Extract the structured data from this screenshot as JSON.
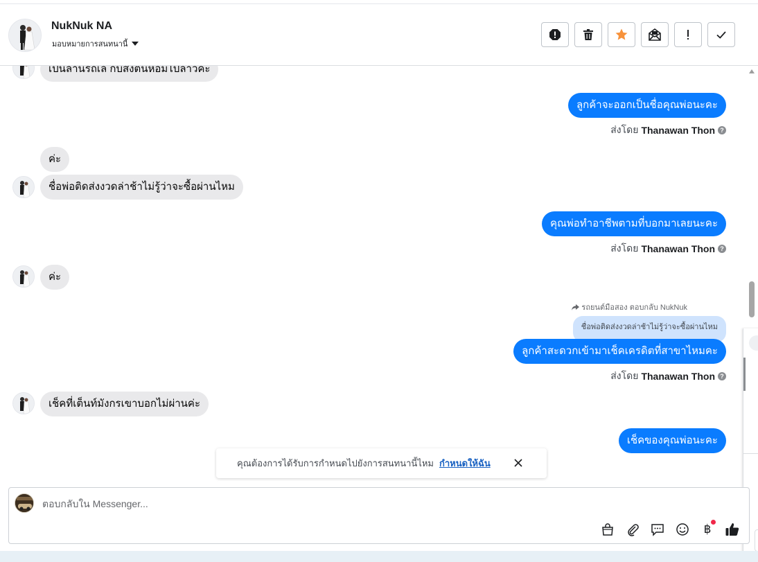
{
  "header": {
    "contact_name": "NukNuk NA",
    "assign_label": "มอบหมายการสนทนานี้",
    "actions": [
      {
        "name": "spam-button",
        "icon": "alert-octagon-icon"
      },
      {
        "name": "delete-button",
        "icon": "trash-icon"
      },
      {
        "name": "star-button",
        "icon": "star-icon"
      },
      {
        "name": "mark-unread-button",
        "icon": "mail-open-icon"
      },
      {
        "name": "follow-up-button",
        "icon": "exclamation-icon"
      },
      {
        "name": "mark-done-button",
        "icon": "check-icon"
      }
    ],
    "star_color": "#f7923b"
  },
  "messages": [
    {
      "dir": "in",
      "text": "เป็นลานรถเล กับสังตนหอมไปลาวคะ"
    },
    {
      "dir": "out",
      "text": "ลูกค้าจะออกเป็นชื่อคุณพ่อนะคะ",
      "sent_by_prefix": "ส่งโดย",
      "sent_by_name": "Thanawan Thon"
    },
    {
      "dir": "in",
      "text": "ค่ะ"
    },
    {
      "dir": "in",
      "text": "ชื่อพ่อติดส่งงวดล่าช้าไม่รู้ว่าจะซื้อผ่านไหม"
    },
    {
      "dir": "out",
      "text": "คุณพ่อทำอาชีพตามที่บอกมาเลยนะคะ",
      "sent_by_prefix": "ส่งโดย",
      "sent_by_name": "Thanawan Thon"
    },
    {
      "dir": "in",
      "text": "ค่ะ"
    },
    {
      "dir": "out",
      "reply_meta": "รถยนต์มือสอง ตอบกลับ NukNuk",
      "quoted": "ชื่อพ่อติดส่งงวดล่าช้าไม่รู้ว่าจะซื้อผ่านไหม",
      "text": "ลูกค้าสะดวกเข้ามาเช็คเครดิตที่สาขาไหมคะ",
      "sent_by_prefix": "ส่งโดย",
      "sent_by_name": "Thanawan Thon"
    },
    {
      "dir": "in",
      "text": "เช็คที่เต็นท์มังกรเขาบอกไม่ผ่านค่ะ"
    },
    {
      "dir": "out",
      "text": "เช็คของคุณพ่อนะคะ"
    }
  ],
  "toast": {
    "text": "คุณต้องการได้รับการกำหนดไปยังการสนทนานี้ไหม",
    "link": "กำหนดให้ฉัน"
  },
  "composer": {
    "placeholder": "ตอบกลับใน Messenger...",
    "value": "",
    "tools": [
      "shopping-bag-icon",
      "paperclip-icon",
      "saved-reply-icon",
      "emoji-icon",
      "baht-payment-icon",
      "thumbs-up-icon"
    ],
    "baht_symbol": "฿"
  },
  "colors": {
    "outgoing_bubble": "#0a7cff",
    "incoming_bubble": "#e9e9eb",
    "quoted_bubble": "#cfe3fd",
    "link": "#1861c2"
  }
}
